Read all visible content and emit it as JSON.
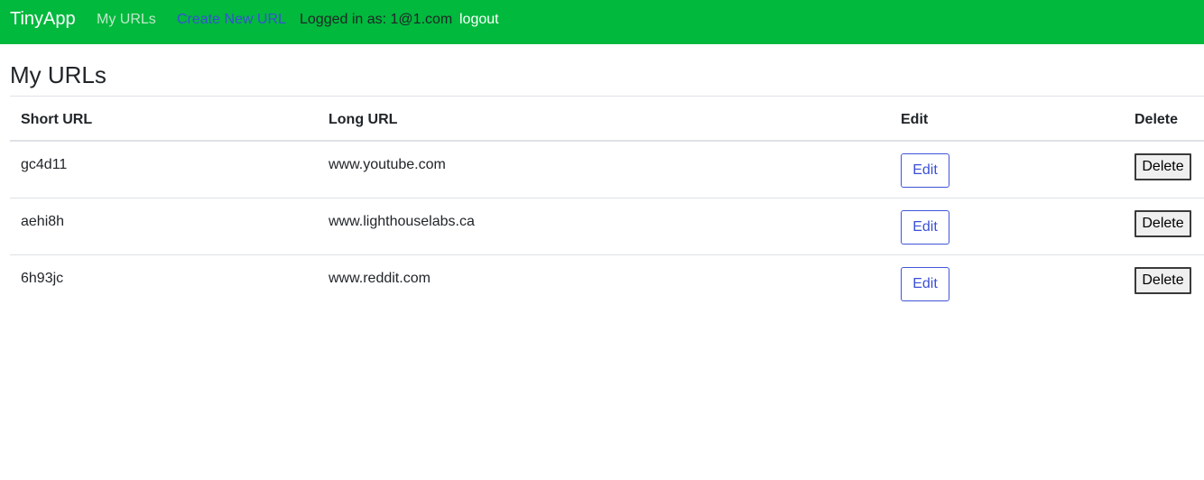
{
  "navbar": {
    "brand": "TinyApp",
    "my_urls": "My URLs",
    "create_new_url": "Create New URL",
    "logged_in_as": "Logged in as: 1@1.com",
    "logout": "logout",
    "colors": {
      "background": "#00b93d",
      "brand": "#ffffff",
      "my_urls": "#bfe8c9",
      "create_new_url": "#3a4fd6",
      "logout": "#ffffff"
    }
  },
  "page": {
    "title": "My URLs"
  },
  "table": {
    "headers": [
      "Short URL",
      "Long URL",
      "Edit",
      "Delete"
    ],
    "rows": [
      {
        "short_url": "gc4d11",
        "long_url": "www.youtube.com",
        "edit_label": "Edit",
        "delete_label": "Delete"
      },
      {
        "short_url": "aehi8h",
        "long_url": "www.lighthouselabs.ca",
        "edit_label": "Edit",
        "delete_label": "Delete"
      },
      {
        "short_url": "6h93jc",
        "long_url": "www.reddit.com",
        "edit_label": "Edit",
        "delete_label": "Delete"
      }
    ]
  }
}
